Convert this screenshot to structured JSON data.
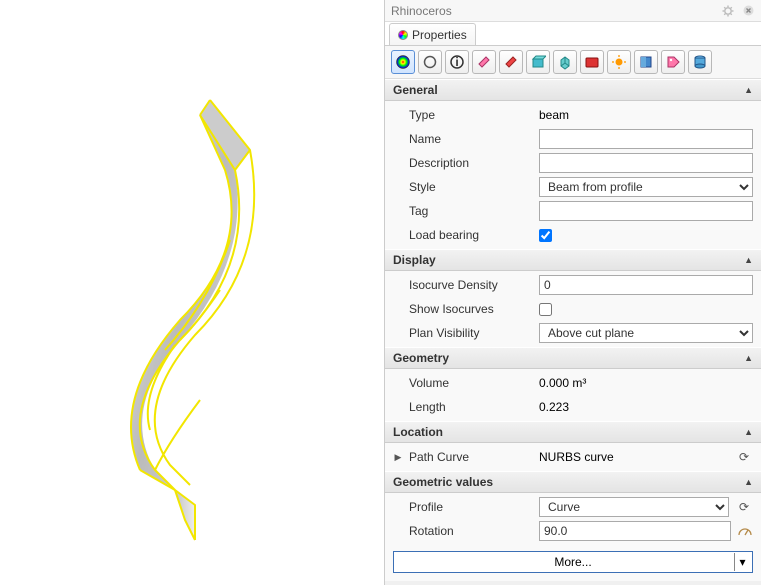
{
  "panel": {
    "title": "Rhinoceros",
    "tab_label": "Properties"
  },
  "toolbar": {
    "icons": [
      "color-wheel-icon",
      "circle-icon",
      "info-icon",
      "eraser-pink-icon",
      "eraser-red-icon",
      "box-teal-icon",
      "cube-icon",
      "folder-red-icon",
      "sun-icon",
      "book-icon",
      "tag-icon",
      "cylinder-icon"
    ]
  },
  "sections": {
    "general": {
      "title": "General",
      "type_label": "Type",
      "type_value": "beam",
      "name_label": "Name",
      "name_value": "",
      "desc_label": "Description",
      "desc_value": "",
      "style_label": "Style",
      "style_value": "Beam from profile",
      "tag_label": "Tag",
      "tag_value": "",
      "load_label": "Load bearing",
      "load_checked": true
    },
    "display": {
      "title": "Display",
      "iso_label": "Isocurve Density",
      "iso_value": "0",
      "show_label": "Show Isocurves",
      "show_checked": false,
      "vis_label": "Plan Visibility",
      "vis_value": "Above cut plane"
    },
    "geometry": {
      "title": "Geometry",
      "vol_label": "Volume",
      "vol_value": "0.000 m³",
      "len_label": "Length",
      "len_value": "0.223"
    },
    "location": {
      "title": "Location",
      "path_label": "Path Curve",
      "path_value": "NURBS curve"
    },
    "geovals": {
      "title": "Geometric values",
      "profile_label": "Profile",
      "profile_value": "Curve",
      "rot_label": "Rotation",
      "rot_value": "90.0"
    }
  },
  "more_label": "More..."
}
